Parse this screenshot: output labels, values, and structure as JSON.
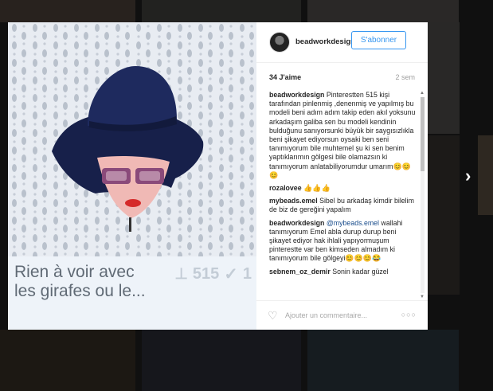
{
  "background": {
    "color": "#2a2a2a"
  },
  "modal": {
    "username": "beadworkdesign",
    "follow_label": "S'abonner",
    "likes": "34 J'aime",
    "age": "2 sem",
    "pin_card": {
      "title": "Rien à voir avec les girafes ou le...",
      "pins": "515",
      "likes": "1"
    },
    "comments": [
      {
        "author": "beadworkdesign",
        "text": "Pinterestten 515 kişi tarafından pinlenmiş ,denenmiş ve yapılmış bu modeli beni adım adım takip eden akıl yoksunu arkadaşım galiba sen bu modeli kendinin bulduğunu sanıyorsunki büyük bir saygısızlıkla beni şikayet ediyorsun oysaki ben seni tanımıyorum bile muhtemel şu ki sen benim yaptıklarımın gölgesi bile olamazsın ki tanımıyorum anlatabiliyorumdur umarım",
        "emoji": "😊😊😊"
      },
      {
        "author": "rozalovee",
        "text": "",
        "emoji": "👍👍👍"
      },
      {
        "author": "mybeads.emel",
        "text": "Sibel bu arkadaş kimdir bilelim de biz de gereğini yapalım",
        "emoji": ""
      },
      {
        "author": "beadworkdesign",
        "mention": "@mybeads.emel",
        "text": "wallahi tanımıyorum Emel abla durup durup beni şikayet ediyor hak ihlali yapıyormuşum pinterestte var ben kimseden almadım ki tanımıyorum bile gölgeyi",
        "emoji": "😊😊😊😂"
      },
      {
        "author": "sebnem_oz_demir",
        "text": "Sonin kadar güzel",
        "emoji": ""
      }
    ],
    "add_comment_placeholder": "Ajouter un commentaire...",
    "more_label": "○○○"
  },
  "icons": {
    "heart": "heart-outline-icon",
    "pin": "pushpin-icon",
    "check": "check-icon",
    "next": "chevron-right-icon"
  }
}
